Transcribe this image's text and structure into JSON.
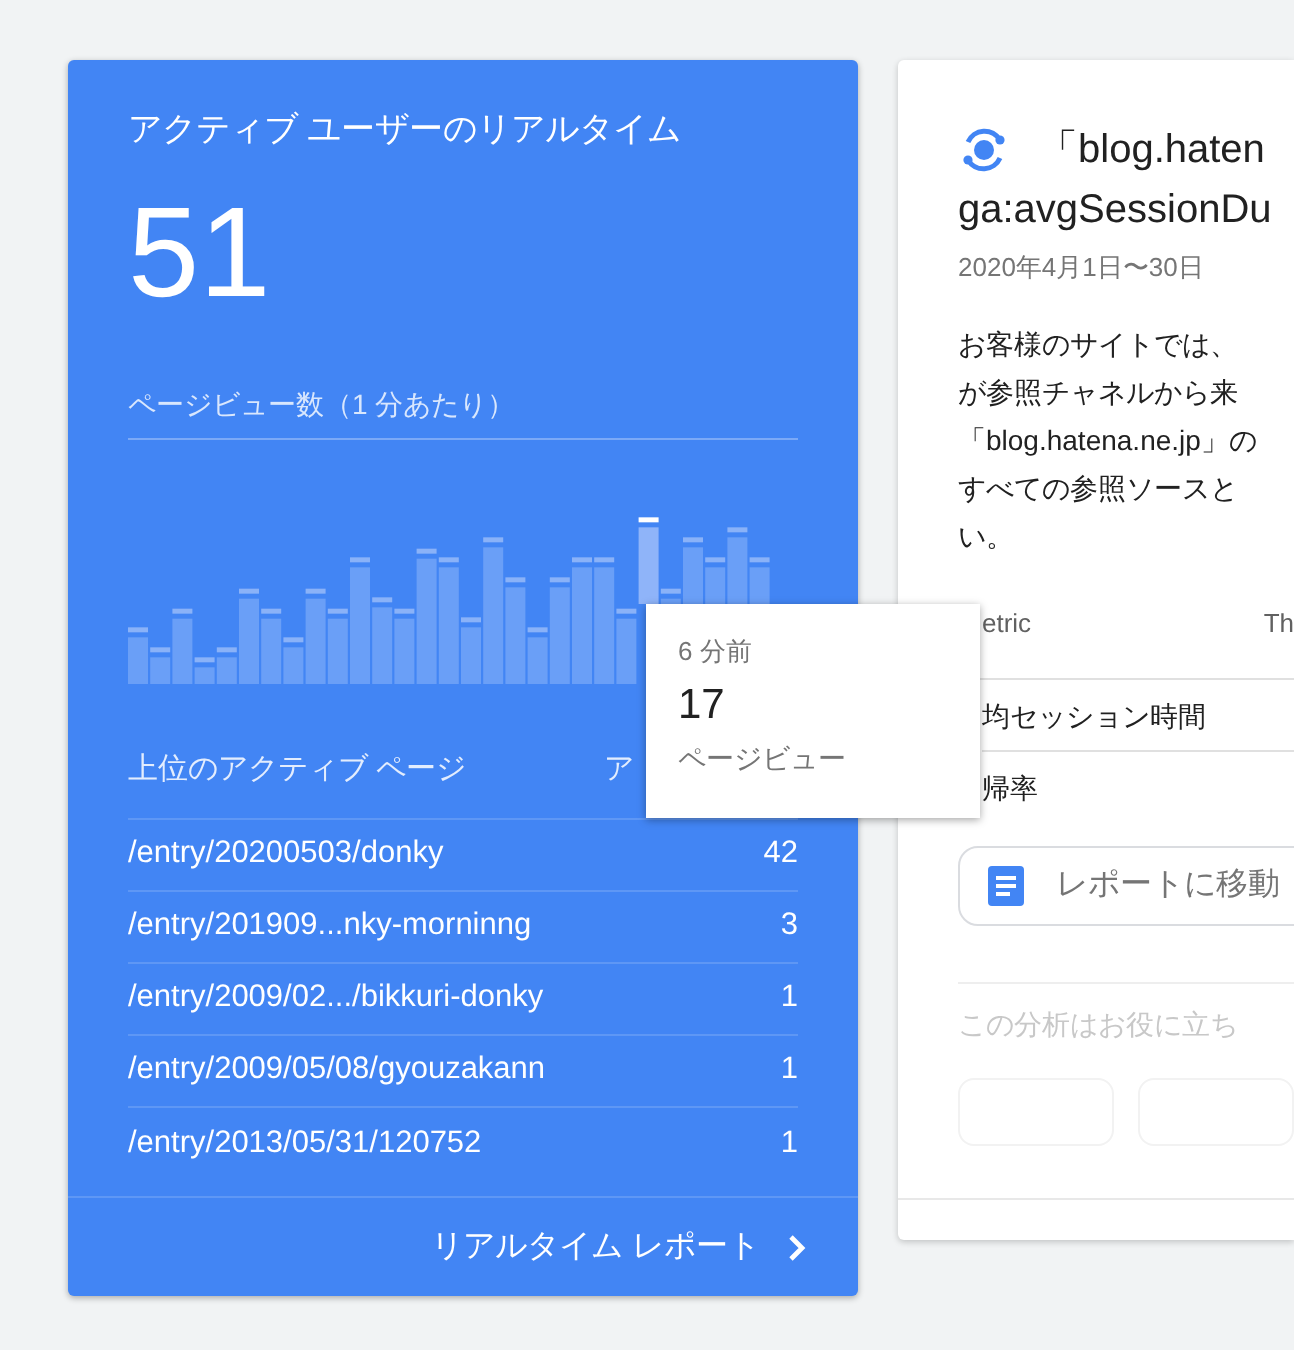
{
  "realtime_card": {
    "title": "アクティブ ユーザーのリアルタイム",
    "active_users": "51",
    "pageviews_label": "ページビュー数（1 分あたり）",
    "chart_tooltip": {
      "time": "6 分前",
      "value": "17",
      "unit": "ページビュー"
    },
    "top_pages_header": "上位のアクティブ ページ",
    "column_2_header": "ア",
    "pages": [
      {
        "path": "/entry/20200503/donky",
        "count": "42"
      },
      {
        "path": "/entry/201909...nky-morninng",
        "count": "3"
      },
      {
        "path": "/entry/2009/02.../bikkuri-donky",
        "count": "1"
      },
      {
        "path": "/entry/2009/05/08/gyouzakann",
        "count": "1"
      },
      {
        "path": "/entry/2013/05/31/120752",
        "count": "1"
      }
    ],
    "report_link": "リアルタイム レポート"
  },
  "insight_card": {
    "title_lines": [
      "「blog.haten",
      "ga:avgSessionDu"
    ],
    "date": "2020年4月1日〜30日",
    "body_lines": [
      "お客様のサイトでは、",
      "が参照チャネルから来",
      "「blog.hatena.ne.jp」の",
      "すべての参照ソースと",
      "い。"
    ],
    "table": {
      "columns": [
        "etric",
        "Th"
      ],
      "rows": [
        "均セッション時間",
        "帰率"
      ]
    },
    "report_button": "レポートに移動",
    "feedback_prompt": "この分析はお役に立ち"
  }
}
